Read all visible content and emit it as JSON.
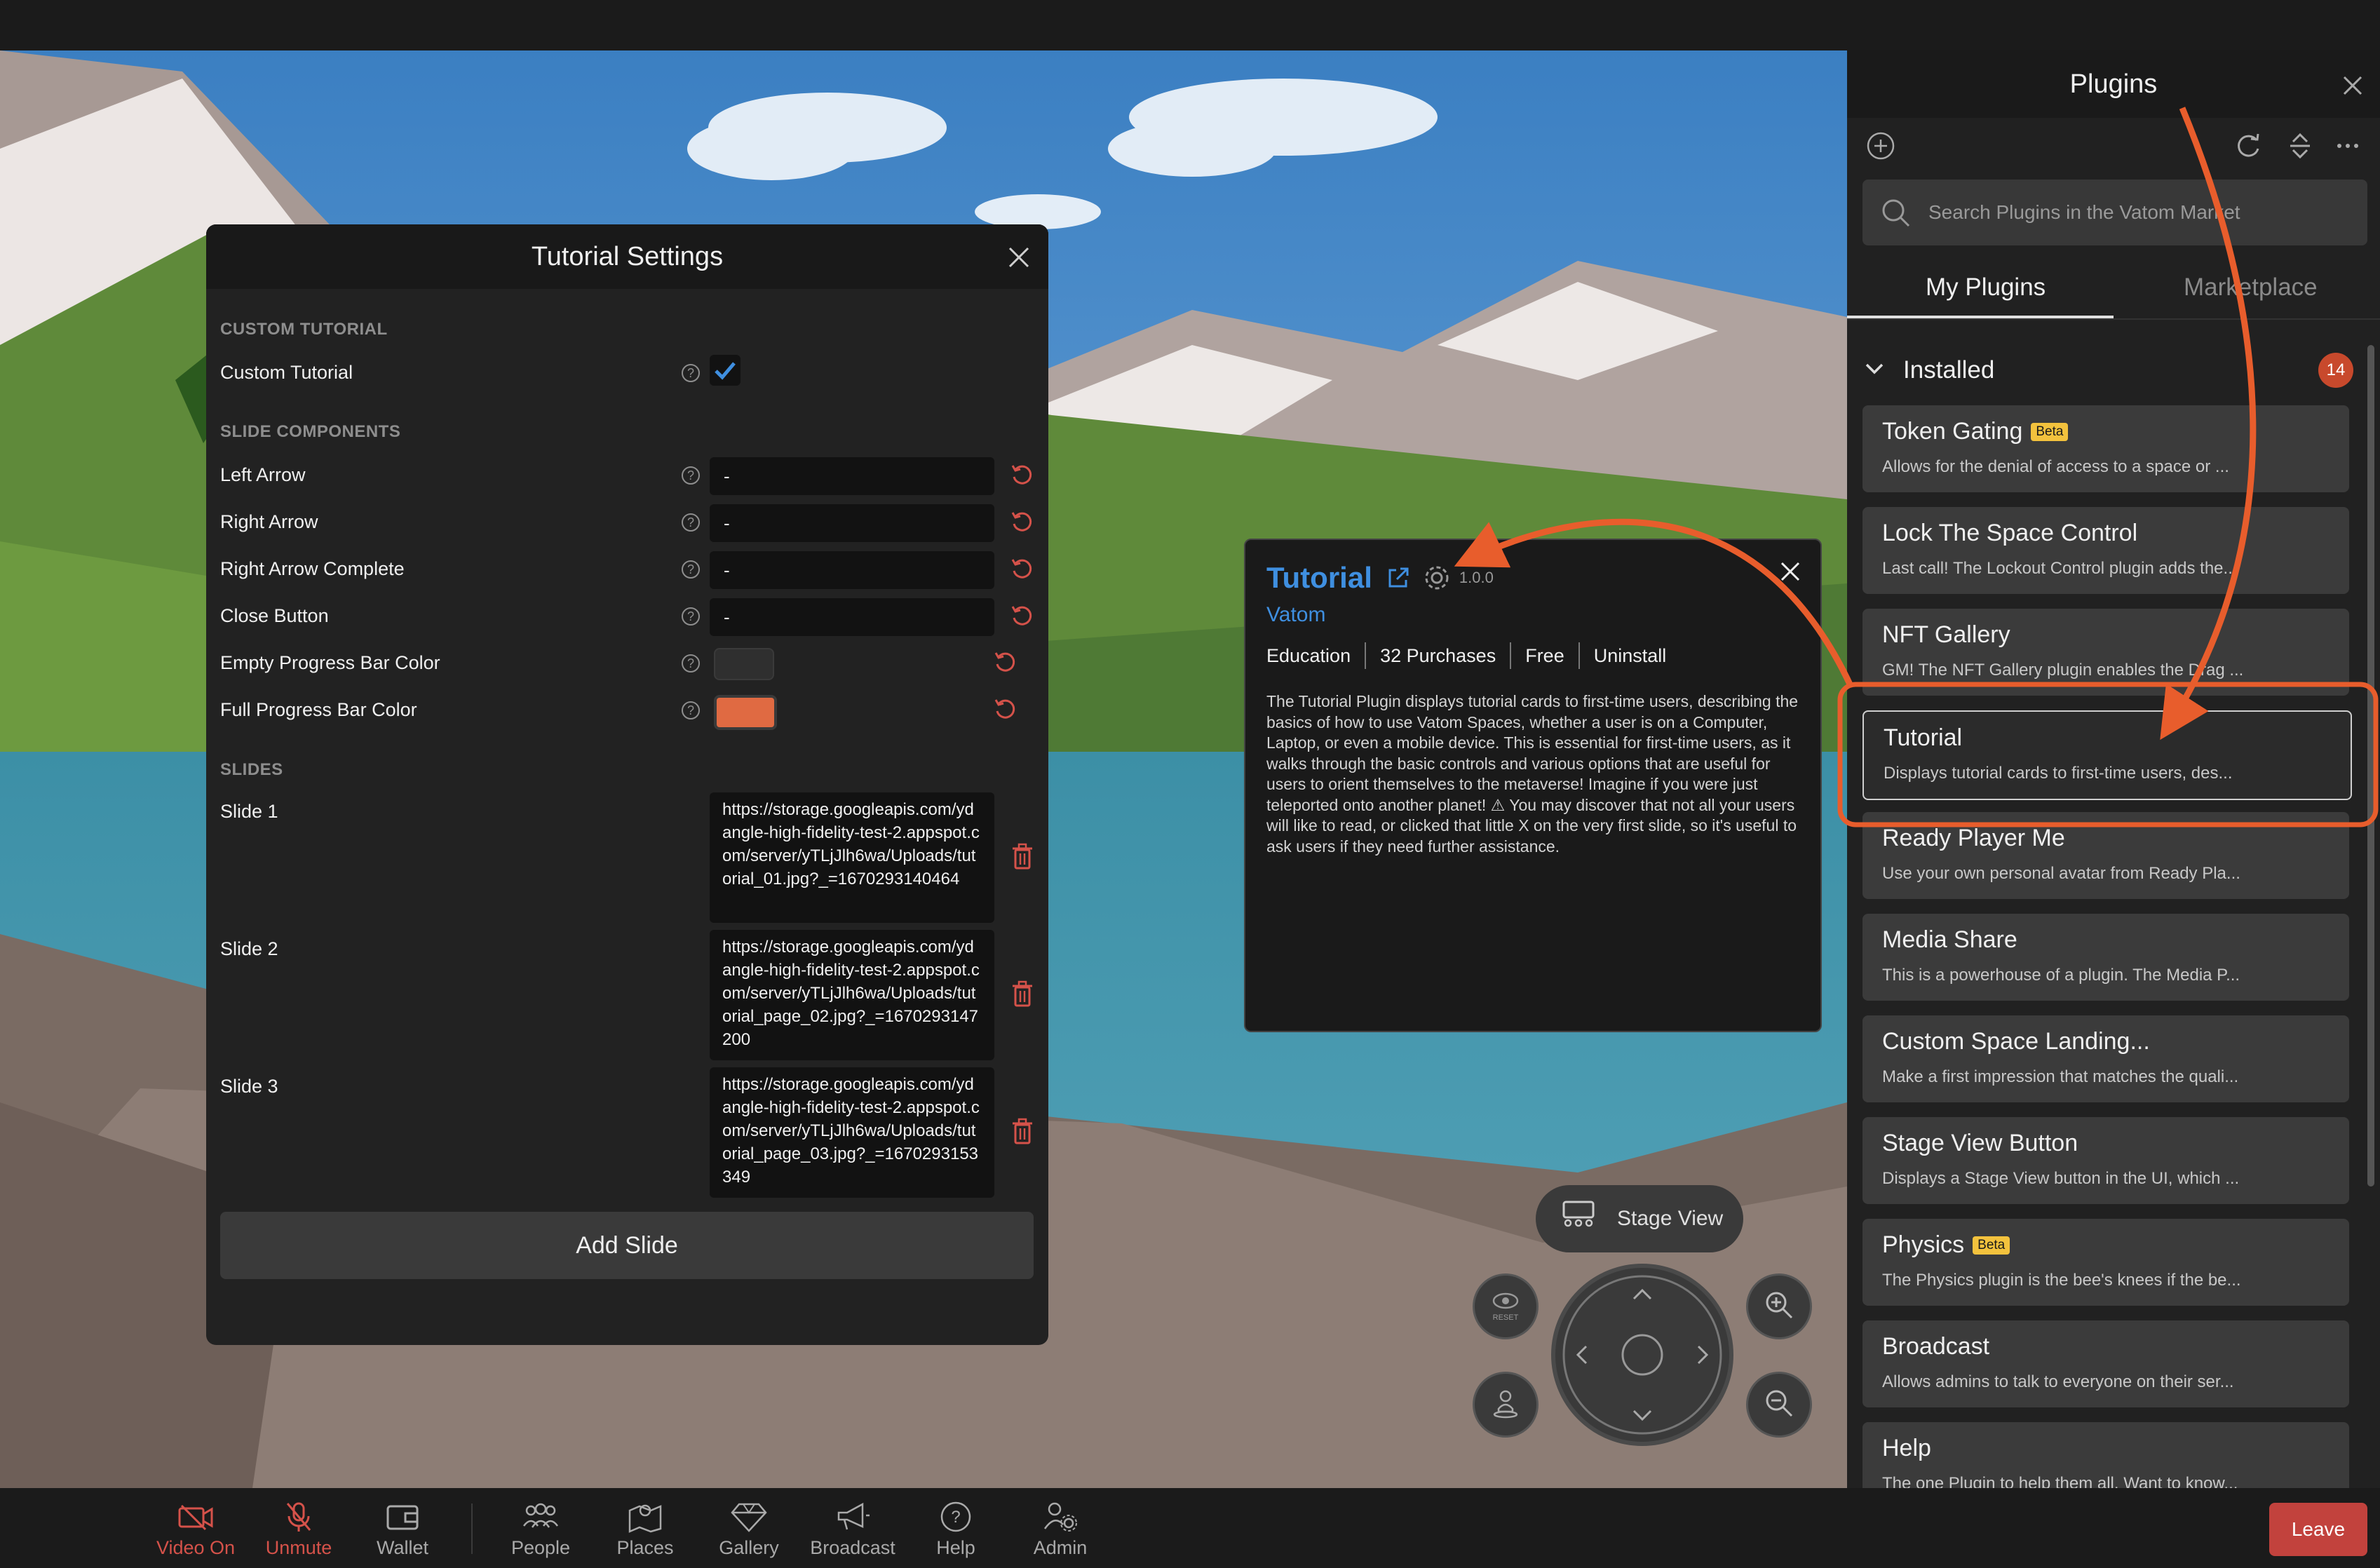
{
  "settings": {
    "title": "Tutorial Settings",
    "sections": {
      "custom_tutorial": "CUSTOM TUTORIAL",
      "slide_components": "SLIDE COMPONENTS",
      "slides": "SLIDES"
    },
    "custom_tutorial_label": "Custom Tutorial",
    "custom_tutorial_checked": true,
    "fields": [
      {
        "label": "Left Arrow",
        "value": "-"
      },
      {
        "label": "Right Arrow",
        "value": "-"
      },
      {
        "label": "Right Arrow Complete",
        "value": "-"
      },
      {
        "label": "Close Button",
        "value": "-"
      }
    ],
    "colors": [
      {
        "label": "Empty Progress Bar Color",
        "value": "#2f2f2f"
      },
      {
        "label": "Full Progress Bar Color",
        "value": "#e06a42"
      }
    ],
    "slides": [
      {
        "label": "Slide 1",
        "url": "https://storage.googleapis.com/ydangle-high-fidelity-test-2.appspot.com/server/yTLjJlh6wa/Uploads/tutorial_01.jpg?_=1670293140464"
      },
      {
        "label": "Slide 2",
        "url": "https://storage.googleapis.com/ydangle-high-fidelity-test-2.appspot.com/server/yTLjJlh6wa/Uploads/tutorial_page_02.jpg?_=1670293147200"
      },
      {
        "label": "Slide 3",
        "url": "https://storage.googleapis.com/ydangle-high-fidelity-test-2.appspot.com/server/yTLjJlh6wa/Uploads/tutorial_page_03.jpg?_=1670293153349"
      }
    ],
    "add_slide": "Add Slide"
  },
  "card": {
    "title": "Tutorial",
    "version": "1.0.0",
    "publisher": "Vatom",
    "category": "Education",
    "purchases": "32 Purchases",
    "price": "Free",
    "action": "Uninstall",
    "description": "The Tutorial Plugin displays tutorial cards to first-time users, describing the basics of how to use Vatom Spaces, whether a user is on a Computer, Laptop, or even a mobile device. This is essential for first-time users, as it walks through the basic controls and various options that are useful for users to orient themselves to the metaverse! Imagine if you were just teleported onto another planet! ⚠ You may discover that not all your users will like to read, or clicked that little X on the very first slide, so it's useful to ask users if they need further assistance."
  },
  "plugins": {
    "title": "Plugins",
    "search_placeholder": "Search Plugins in the Vatom Market",
    "tabs": [
      "My Plugins",
      "Marketplace"
    ],
    "installed_label": "Installed",
    "installed_count": "14",
    "items": [
      {
        "name": "Token Gating",
        "badge": "Beta",
        "desc": "Allows for the denial of access to a space or ..."
      },
      {
        "name": "Lock The Space Control",
        "badge": "",
        "desc": "Last call! The Lockout Control plugin adds the..."
      },
      {
        "name": "NFT Gallery",
        "badge": "",
        "desc": "GM! The NFT Gallery plugin enables the Drag ..."
      },
      {
        "name": "Tutorial",
        "badge": "",
        "desc": "Displays tutorial cards to first-time users, des..."
      },
      {
        "name": "Ready Player Me",
        "badge": "",
        "desc": "Use your own personal avatar from Ready Pla..."
      },
      {
        "name": "Media Share",
        "badge": "",
        "desc": "This is a powerhouse of a plugin. The Media P..."
      },
      {
        "name": "Custom Space Landing...",
        "badge": "",
        "desc": "Make a first impression that matches the quali..."
      },
      {
        "name": "Stage View Button",
        "badge": "",
        "desc": "Displays a Stage View button in the UI, which ..."
      },
      {
        "name": "Physics",
        "badge": "Beta",
        "desc": "The Physics plugin is the bee's knees if the be..."
      },
      {
        "name": "Broadcast",
        "badge": "",
        "desc": "Allows admins to talk to everyone on their ser..."
      },
      {
        "name": "Help",
        "badge": "",
        "desc": "The one Plugin to help them all. Want to know..."
      }
    ]
  },
  "scene": {
    "stage_view": "Stage View",
    "reset": "RESET"
  },
  "bottombar": {
    "items": [
      "Video On",
      "Unmute",
      "Wallet",
      "People",
      "Places",
      "Gallery",
      "Broadcast",
      "Help",
      "Admin"
    ],
    "leave": "Leave"
  },
  "colors": {
    "accent_blue": "#3f8fe0",
    "annotation_orange": "#e85d2c",
    "danger_red": "#d5524a",
    "badge_yellow": "#f3c23d"
  }
}
